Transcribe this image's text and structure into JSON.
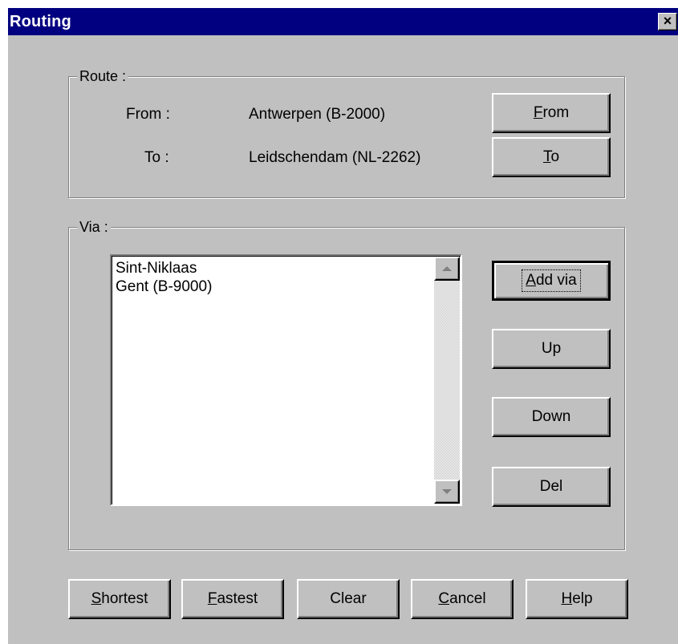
{
  "window": {
    "title": "Routing",
    "close_glyph": "×"
  },
  "route": {
    "legend": "Route :",
    "from_label": "From :",
    "from_value": "Antwerpen (B-2000)",
    "to_label": "To :",
    "to_value": "Leidschendam (NL-2262)",
    "from_button": {
      "mnemonic": "F",
      "rest": "rom"
    },
    "to_button": {
      "mnemonic": "T",
      "rest": "o"
    }
  },
  "via": {
    "legend": "Via :",
    "items": [
      "Sint-Niklaas",
      "Gent (B-9000)"
    ],
    "add_button": {
      "mnemonic": "A",
      "rest": "dd via"
    },
    "up_label": "Up",
    "down_label": "Down",
    "del_label": "Del"
  },
  "footer": {
    "shortest": {
      "mnemonic": "S",
      "rest": "hortest"
    },
    "fastest": {
      "mnemonic": "F",
      "rest": "astest"
    },
    "clear": "Clear",
    "cancel": {
      "mnemonic": "C",
      "rest": "ancel"
    },
    "help": {
      "mnemonic": "H",
      "rest": "elp"
    }
  },
  "icons": {
    "close": "close-icon",
    "scroll_up": "scroll-up-arrow-icon",
    "scroll_down": "scroll-down-arrow-icon"
  },
  "colors": {
    "titlebar": "#000080",
    "face": "#c0c0c0",
    "shadow": "#808080",
    "highlight": "#ffffff"
  }
}
